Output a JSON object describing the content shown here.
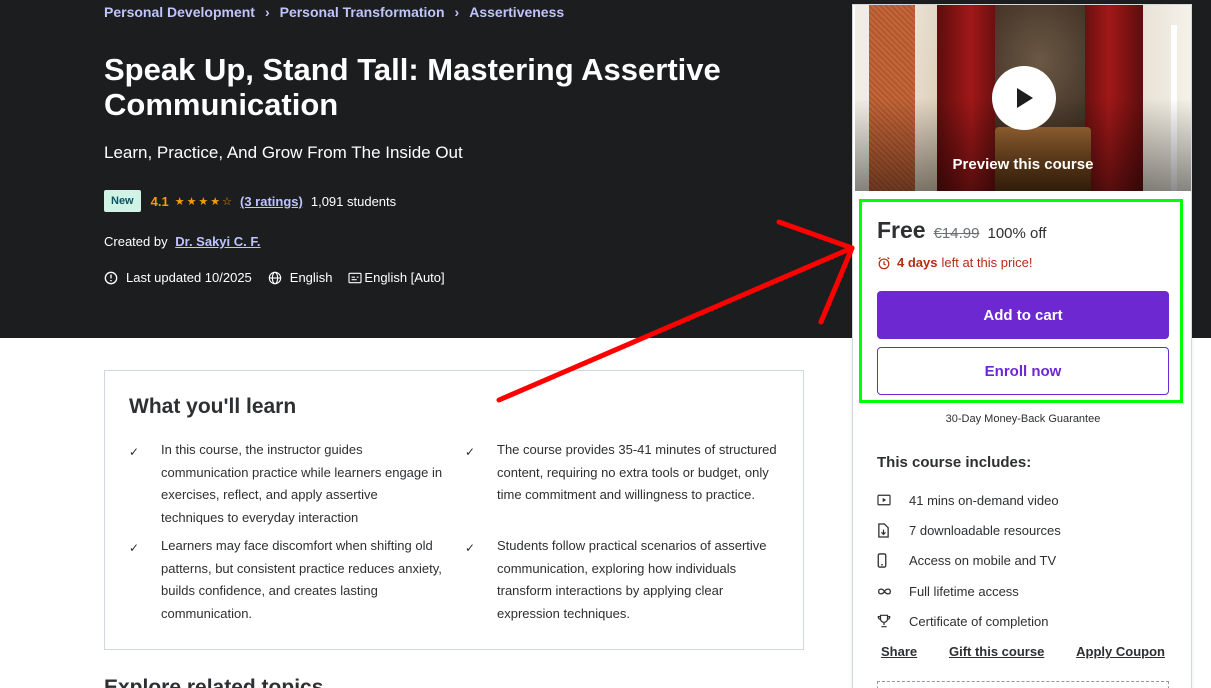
{
  "breadcrumb": [
    "Personal Development",
    "Personal Transformation",
    "Assertiveness"
  ],
  "course": {
    "title": "Speak Up, Stand Tall: Mastering Assertive Communication",
    "subtitle": "Learn, Practice, And Grow From The Inside Out",
    "badge": "New",
    "rating": "4.1",
    "rating_stars": 4.1,
    "ratings_count": "(3 ratings)",
    "students": "1,091 students",
    "created_by_label": "Created by",
    "instructor": "Dr. Sakyi C. F.",
    "last_updated": "Last updated 10/2025",
    "language": "English",
    "captions": "English [Auto]"
  },
  "learn": {
    "heading": "What you'll learn",
    "items": [
      "In this course, the instructor guides communication practice while learners engage in exercises, reflect, and apply assertive techniques to everyday interaction",
      "The course provides 35-41 minutes of structured content, requiring no extra tools or budget, only time commitment and willingness to practice.",
      "Learners may face discomfort when shifting old patterns, but consistent practice reduces anxiety, builds confidence, and creates lasting communication.",
      "Students follow practical scenarios of assertive communication, exploring how individuals transform interactions by applying clear expression techniques."
    ]
  },
  "next_section": {
    "heading": "Explore related topics"
  },
  "sidebar": {
    "preview_label": "Preview this course",
    "price": "Free",
    "original_price": "€14.99",
    "discount": "100% off",
    "timer_days": "4 days",
    "timer_text": "left at this price!",
    "add_to_cart": "Add to cart",
    "enroll": "Enroll now",
    "guarantee": "30-Day Money-Back Guarantee",
    "includes_title": "This course includes:",
    "includes": [
      {
        "icon": "video-icon",
        "label": "41 mins on-demand video"
      },
      {
        "icon": "file-download-icon",
        "label": "7 downloadable resources"
      },
      {
        "icon": "mobile-icon",
        "label": "Access on mobile and TV"
      },
      {
        "icon": "infinity-icon",
        "label": "Full lifetime access"
      },
      {
        "icon": "trophy-icon",
        "label": "Certificate of completion"
      }
    ],
    "links": {
      "share": "Share",
      "gift": "Gift this course",
      "coupon": "Apply Coupon"
    }
  },
  "colors": {
    "hero_bg": "#1c1d1f",
    "link_purple_light": "#c0c4fc",
    "brand_purple": "#6d28d2",
    "star": "#f69c08",
    "timer_red": "#b32d0f",
    "annotation_green": "#00ff00",
    "annotation_red": "#ff0000"
  }
}
